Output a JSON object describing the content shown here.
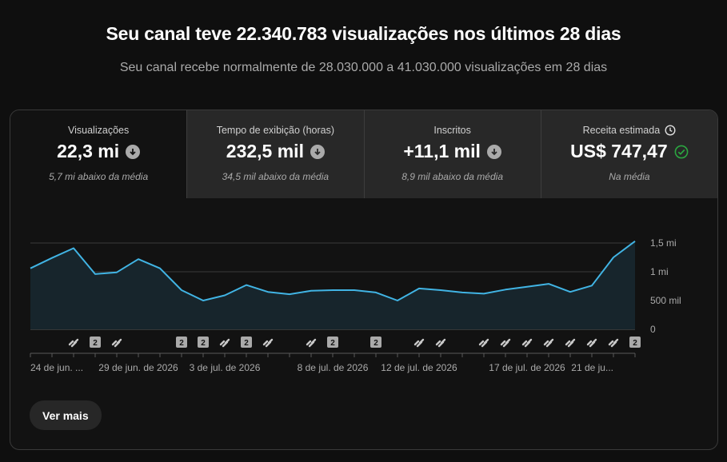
{
  "header": {
    "title": "Seu canal teve 22.340.783 visualizações nos últimos 28 dias",
    "subtitle": "Seu canal recebe normalmente de 28.030.000 a 41.030.000 visualizações em 28 dias"
  },
  "tabs": [
    {
      "label": "Visualizações",
      "value": "22,3 mi",
      "note": "5,7 mi abaixo da média",
      "status": "below"
    },
    {
      "label": "Tempo de exibição (horas)",
      "value": "232,5 mil",
      "note": "34,5 mil abaixo da média",
      "status": "below"
    },
    {
      "label": "Inscritos",
      "value": "+11,1 mil",
      "note": "8,9 mil abaixo da média",
      "status": "below"
    },
    {
      "label": "Receita estimada",
      "value": "US$ 747,47",
      "note": "Na média",
      "status": "normal"
    }
  ],
  "colors": {
    "line": "#41b4e4",
    "fill": "#17252c",
    "check": "#2ba640",
    "marker": "#aaaaaa"
  },
  "chart_data": {
    "type": "area",
    "x": [
      "2026-06-24",
      "2026-06-25",
      "2026-06-26",
      "2026-06-27",
      "2026-06-28",
      "2026-06-29",
      "2026-06-30",
      "2026-07-01",
      "2026-07-02",
      "2026-07-03",
      "2026-07-04",
      "2026-07-05",
      "2026-07-06",
      "2026-07-07",
      "2026-07-08",
      "2026-07-09",
      "2026-07-10",
      "2026-07-11",
      "2026-07-12",
      "2026-07-13",
      "2026-07-14",
      "2026-07-15",
      "2026-07-16",
      "2026-07-17",
      "2026-07-18",
      "2026-07-19",
      "2026-07-20",
      "2026-07-21",
      "2026-07-22"
    ],
    "series": [
      {
        "values": [
          1060000,
          1240000,
          1410000,
          960000,
          990000,
          1220000,
          1060000,
          680000,
          500000,
          590000,
          770000,
          650000,
          610000,
          670000,
          680000,
          680000,
          640000,
          500000,
          710000,
          680000,
          640000,
          620000,
          690000,
          740000,
          790000,
          650000,
          760000,
          1250000,
          1530000
        ]
      }
    ],
    "x_tick_labels": [
      "24 de jun. ...",
      "29 de jun. de 2026",
      "3 de jul. de 2026",
      "8 de jul. de 2026",
      "12 de jul. de 2026",
      "17 de jul. de 2026",
      "21 de ju..."
    ],
    "x_tick_dates": [
      "2026-06-24",
      "2026-06-29",
      "2026-07-03",
      "2026-07-08",
      "2026-07-12",
      "2026-07-17",
      "2026-07-21"
    ],
    "y_ticks": [
      0,
      500000,
      1000000,
      1500000
    ],
    "y_tick_labels": [
      "0",
      "500 mil",
      "1 mi",
      "1,5 mi"
    ],
    "ylim": [
      0,
      1500000
    ],
    "grid": true,
    "markers": [
      {
        "date": "2026-06-26",
        "type": "link"
      },
      {
        "date": "2026-06-27",
        "type": "count",
        "label": "2"
      },
      {
        "date": "2026-06-28",
        "type": "link"
      },
      {
        "date": "2026-07-01",
        "type": "count",
        "label": "2"
      },
      {
        "date": "2026-07-02",
        "type": "count",
        "label": "2"
      },
      {
        "date": "2026-07-03",
        "type": "link"
      },
      {
        "date": "2026-07-04",
        "type": "count",
        "label": "2"
      },
      {
        "date": "2026-07-05",
        "type": "link"
      },
      {
        "date": "2026-07-07",
        "type": "link"
      },
      {
        "date": "2026-07-08",
        "type": "count",
        "label": "2"
      },
      {
        "date": "2026-07-10",
        "type": "count",
        "label": "2"
      },
      {
        "date": "2026-07-12",
        "type": "link"
      },
      {
        "date": "2026-07-13",
        "type": "link"
      },
      {
        "date": "2026-07-15",
        "type": "link"
      },
      {
        "date": "2026-07-16",
        "type": "link"
      },
      {
        "date": "2026-07-17",
        "type": "link"
      },
      {
        "date": "2026-07-18",
        "type": "link"
      },
      {
        "date": "2026-07-19",
        "type": "link"
      },
      {
        "date": "2026-07-20",
        "type": "link"
      },
      {
        "date": "2026-07-21",
        "type": "link"
      },
      {
        "date": "2026-07-22",
        "type": "count",
        "label": "2"
      }
    ]
  },
  "footer": {
    "see_more": "Ver mais"
  }
}
